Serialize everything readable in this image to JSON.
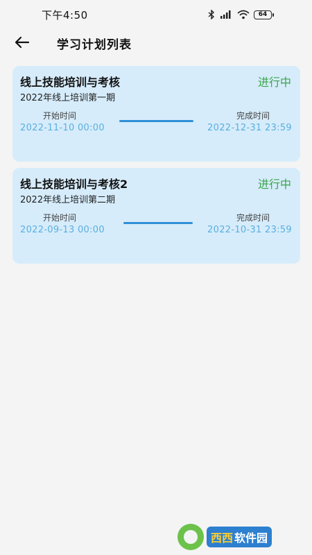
{
  "status_bar": {
    "time": "下午4:50",
    "battery": "64",
    "icons": [
      "bluetooth-icon",
      "hd-signal-icon",
      "wifi-icon",
      "battery-icon"
    ]
  },
  "app_bar": {
    "title": "学习计划列表",
    "back_icon": "back-arrow-icon"
  },
  "plans": [
    {
      "title": "线上技能培训与考核",
      "status": "进行中",
      "subtitle": "2022年线上培训第一期",
      "start_label": "开始时间",
      "start_time": "2022-11-10 00:00",
      "end_label": "完成时间",
      "end_time": "2022-12-31 23:59"
    },
    {
      "title": "线上技能培训与考核2",
      "status": "进行中",
      "subtitle": "2022年线上培训第二期",
      "start_label": "开始时间",
      "start_time": "2022-09-13 00:00",
      "end_label": "完成时间",
      "end_time": "2022-10-31 23:59"
    }
  ],
  "watermark": {
    "brand": "西西",
    "text": "软件园"
  },
  "colors": {
    "card_background": "#d6ecfb",
    "status_green": "#3aa44a",
    "time_blue": "#5aaede",
    "connector_blue": "#2f8fd6",
    "page_background": "#f4f4f4"
  }
}
